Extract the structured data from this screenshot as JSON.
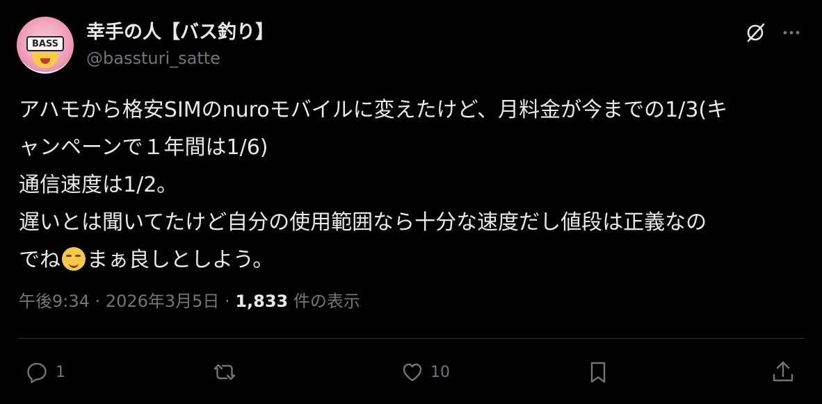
{
  "author": {
    "display_name": "幸手の人【バス釣り】",
    "handle": "@bassturi_satte",
    "avatar_text": "BASS"
  },
  "tweet": {
    "line1": "アハモから格安SIMのnuroモバイルに変えたけど、月料金が今までの1/3(キ",
    "line2": "ャンペーンで１年間は1/6)",
    "line3": "通信速度は1/2。",
    "line4": "遅いとは聞いてたけど自分の使用範囲なら十分な速度だし値段は正義なの",
    "line5_pre": "でね",
    "line5_post": "まぁ良しとしよう。",
    "emoji": "smirking-face"
  },
  "meta": {
    "time": "午後9:34",
    "sep1": " · ",
    "date": "2026年3月5日",
    "sep2": " · ",
    "views_count": "1,833",
    "views_label": " 件の表示"
  },
  "actions": {
    "reply_count": "1",
    "like_count": "10"
  },
  "colors": {
    "background": "#000000",
    "text": "#e7e9ea",
    "muted": "#71767b",
    "divider": "#2f3336"
  }
}
